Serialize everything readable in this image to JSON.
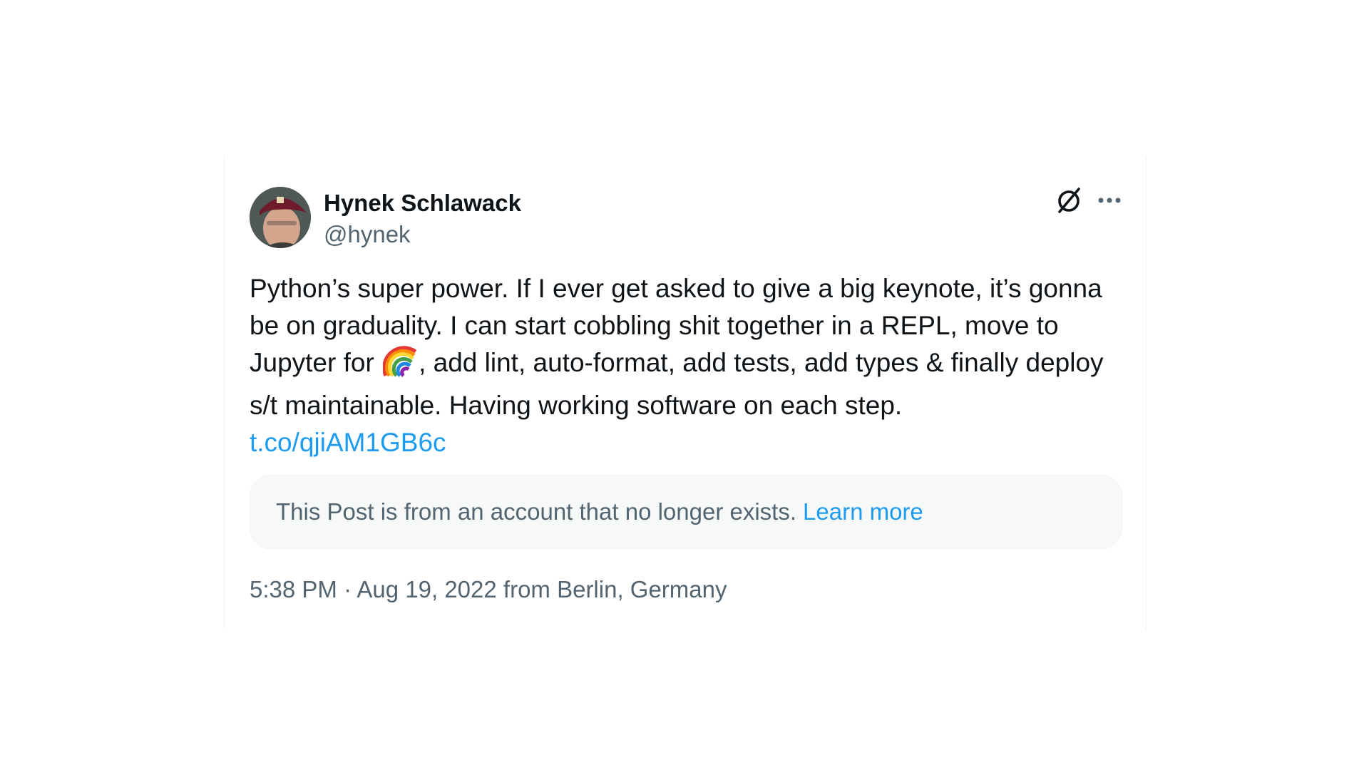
{
  "author": {
    "name": "Hynek Schlawack",
    "handle": "@hynek"
  },
  "post": {
    "text_part1": "Python’s super power. If I ever get asked to give a big keynote, it’s gonna be on graduality. I can start cobbling shit together in a REPL, move to Jupyter for",
    "emoji": "rainbow",
    "text_part2": ", add lint, auto-format, add tests, add types & finally deploy s/t maintainable. Having working software on each step.",
    "link": "t.co/qjiAM1GB6c"
  },
  "notice": {
    "message": "This Post is from an account that no longer exists.",
    "learn_more": "Learn more"
  },
  "meta": {
    "timestamp": "5:38 PM · Aug 19, 2022 from Berlin, Germany"
  },
  "icons": {
    "top_right": [
      "x-logo-icon",
      "more-options-icon"
    ]
  },
  "colors": {
    "link": "#1d9bf0",
    "secondary_text": "#536471",
    "primary_text": "#0f1419"
  }
}
